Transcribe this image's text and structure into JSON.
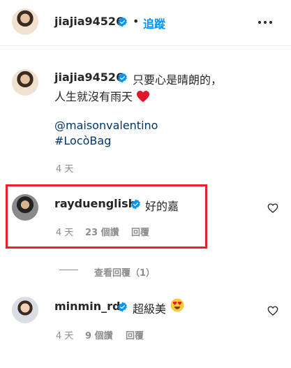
{
  "header": {
    "username": "jiajia94526",
    "separator": "•",
    "follow_label": "追蹤"
  },
  "caption": {
    "username": "jiajia94526",
    "line1": "只要心是晴朗的，",
    "line2": "人生就沒有雨天",
    "mention": "@maisonvalentino",
    "hashtag": "#LocòBag",
    "time": "4 天"
  },
  "comments": [
    {
      "username": "rayduenglish",
      "text": "好的嘉",
      "time": "4 天",
      "likes": "23 個讚",
      "reply_label": "回覆"
    },
    {
      "username": "minmin_rd",
      "text": "超級美",
      "time": "4 天",
      "likes": "9 個讚",
      "reply_label": "回覆"
    }
  ],
  "view_replies": "查看回覆（1）",
  "colors": {
    "accent": "#0095f6",
    "link": "#00376b",
    "highlight_box": "#e2242b"
  }
}
